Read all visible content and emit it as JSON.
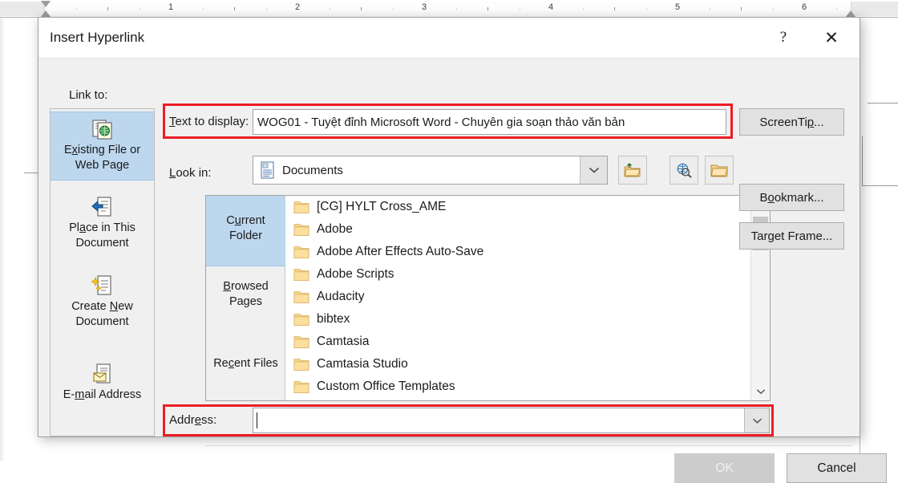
{
  "ruler": {
    "numbers": [
      "1",
      "2",
      "3",
      "4",
      "5",
      "6"
    ],
    "left_indent_icon": "indent-marker-icon",
    "right_indent_icon": "indent-marker-icon"
  },
  "dialog": {
    "title": "Insert Hyperlink",
    "help_glyph": "?",
    "close_glyph": "✕"
  },
  "link_to": {
    "label": "Link to:",
    "items": [
      {
        "id": "existing-file-or-web-page",
        "line1": "Existing File or",
        "line2": "Web Page",
        "accel": "x",
        "icon": "document-globe-icon",
        "selected": true
      },
      {
        "id": "place-in-this-document",
        "line1": "Place in This",
        "line2": "Document",
        "accel": "a",
        "icon": "document-arrow-icon",
        "selected": false
      },
      {
        "id": "create-new-document",
        "line1": "Create New",
        "line2": "Document",
        "accel": "N",
        "icon": "document-sparkle-icon",
        "selected": false
      },
      {
        "id": "e-mail-address",
        "line1": "E-mail Address",
        "line2": "",
        "accel": "m",
        "icon": "document-envelope-icon",
        "selected": false
      }
    ]
  },
  "text_to_display": {
    "label": "Text to display:",
    "value": "WOG01 - Tuyệt đỉnh Microsoft Word - Chuyên gia soạn thảo văn bản",
    "placeholder": "",
    "highlighted": true,
    "highlight_color": "#ed1c24"
  },
  "look_in": {
    "label": "Look in:",
    "value": "Documents",
    "icon": "documents-folder-icon",
    "dropdown_icon": "chevron-down-icon"
  },
  "toolbar": {
    "buttons": [
      {
        "id": "up-one-level",
        "icon": "up-one-level-folder-icon",
        "tooltip": "Up One Folder"
      },
      {
        "id": "browse-web",
        "icon": "browse-the-web-icon",
        "tooltip": "Browse the Web"
      },
      {
        "id": "browse-file",
        "icon": "browse-for-file-icon",
        "tooltip": "Browse for File"
      }
    ]
  },
  "browse_tabs": [
    {
      "id": "current-folder",
      "line1": "Current",
      "line2": "Folder",
      "accel": "u",
      "selected": true
    },
    {
      "id": "browsed-pages",
      "line1": "Browsed",
      "line2": "Pages",
      "accel": "B",
      "selected": false
    },
    {
      "id": "recent-files",
      "line1": "Recent Files",
      "line2": "",
      "accel": "c",
      "selected": false
    }
  ],
  "file_list": {
    "items": [
      {
        "name": "[CG] HYLT Cross_AME",
        "icon": "folder-icon"
      },
      {
        "name": "Adobe",
        "icon": "folder-icon"
      },
      {
        "name": "Adobe After Effects Auto-Save",
        "icon": "folder-icon"
      },
      {
        "name": "Adobe Scripts",
        "icon": "folder-icon"
      },
      {
        "name": "Audacity",
        "icon": "folder-icon"
      },
      {
        "name": "bibtex",
        "icon": "folder-icon"
      },
      {
        "name": "Camtasia",
        "icon": "folder-icon"
      },
      {
        "name": "Camtasia Studio",
        "icon": "folder-icon"
      },
      {
        "name": "Custom Office Templates",
        "icon": "folder-icon"
      }
    ],
    "scrollbar": {
      "up_icon": "chevron-up-icon",
      "down_icon": "chevron-down-icon",
      "thumb_position": "near-top"
    }
  },
  "address": {
    "label": "Address:",
    "value": "",
    "placeholder": "",
    "focused": true,
    "highlighted": true,
    "highlight_color": "#ed1c24",
    "dropdown_icon": "chevron-down-icon"
  },
  "side_buttons": [
    {
      "id": "screentip",
      "label": "ScreenTip...",
      "accel": "p",
      "enabled": true
    },
    {
      "id": "bookmark",
      "label": "Bookmark...",
      "accel": "o",
      "enabled": true
    },
    {
      "id": "target-frame",
      "label": "Target Frame...",
      "accel": "g",
      "enabled": true
    }
  ],
  "footer": {
    "ok_label": "OK",
    "ok_enabled": false,
    "cancel_label": "Cancel",
    "cancel_enabled": true
  }
}
